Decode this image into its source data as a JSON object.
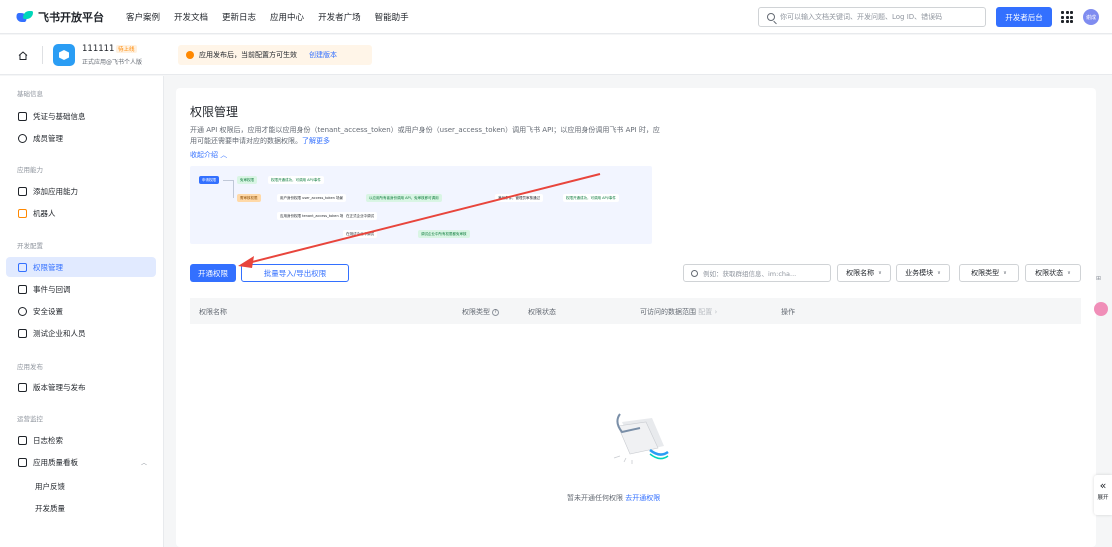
{
  "topbar": {
    "logo_text": "飞书开放平台",
    "nav": [
      "客户案例",
      "开发文档",
      "更新日志",
      "应用中心",
      "开发者广场",
      "智能助手"
    ],
    "search_placeholder": "你可以输入文档关键词、开发问题、Log ID、错误码",
    "dev_console_label": "开发者后台",
    "avatar_text": "谢成"
  },
  "app": {
    "name": "111111",
    "status_badge": "待上线",
    "subtitle": "正式应用@飞书个人版",
    "notice_text": "应用发布后，当前配置方可生效",
    "notice_link": "创建版本"
  },
  "sidebar": {
    "groups": [
      {
        "title": "基础信息",
        "items": [
          "凭证与基础信息",
          "成员管理"
        ]
      },
      {
        "title": "应用能力",
        "items": [
          "添加应用能力",
          "机器人"
        ]
      },
      {
        "title": "开发配置",
        "items": [
          "权限管理",
          "事件与回调",
          "安全设置",
          "测试企业和人员"
        ]
      },
      {
        "title": "应用发布",
        "items": [
          "版本管理与发布"
        ]
      },
      {
        "title": "运营监控",
        "items": [
          "日志检索",
          "应用质量看板"
        ],
        "subitems": [
          "用户反馈",
          "开发质量"
        ]
      }
    ],
    "active_item": "权限管理"
  },
  "main": {
    "title": "权限管理",
    "description": "开通 API 权限后，应用才能以应用身份（tenant_access_token）或用户身份（user_access_token）调用飞书 API；以应用身份调用飞书 API 时，应用可能还需要申请对应的数据权限。",
    "learn_more": "了解更多",
    "collapse_label": "收起介绍",
    "flow": {
      "start": "申请权限",
      "row1": [
        "免审权限",
        "权限开通成功，可调用 API/事件"
      ],
      "row2": [
        "需审核权限",
        "用户身份权限 user_access_token 场景",
        "以应用所有者身份调用 API，免审核即可调用",
        "满足条件，管理员审核通过",
        "权限开通成功，可调用 API/事件"
      ],
      "row3": [
        "应用身份权限 tenant_access_token 场景",
        "在正式企业中调试"
      ],
      "row4": [
        "在测试企业中调试",
        "调试企业中所有权限都免审核"
      ]
    },
    "open_button": "开通权限",
    "batch_button": "批量导入/导出权限",
    "table_search_placeholder": "例如：获取群组信息、im:cha...",
    "filters": [
      "权限名称",
      "业务模块",
      "权限类型",
      "权限状态"
    ],
    "columns": [
      "权限名称",
      "权限类型",
      "权限状态",
      "可访问的数据范围",
      "配置",
      "操作"
    ],
    "empty_text": "暂未开通任何权限",
    "empty_link": "去开通权限"
  },
  "right_panel": {
    "expand_label": "展开"
  },
  "colors": {
    "primary": "#3370ff",
    "annotation": "#e8453c"
  }
}
